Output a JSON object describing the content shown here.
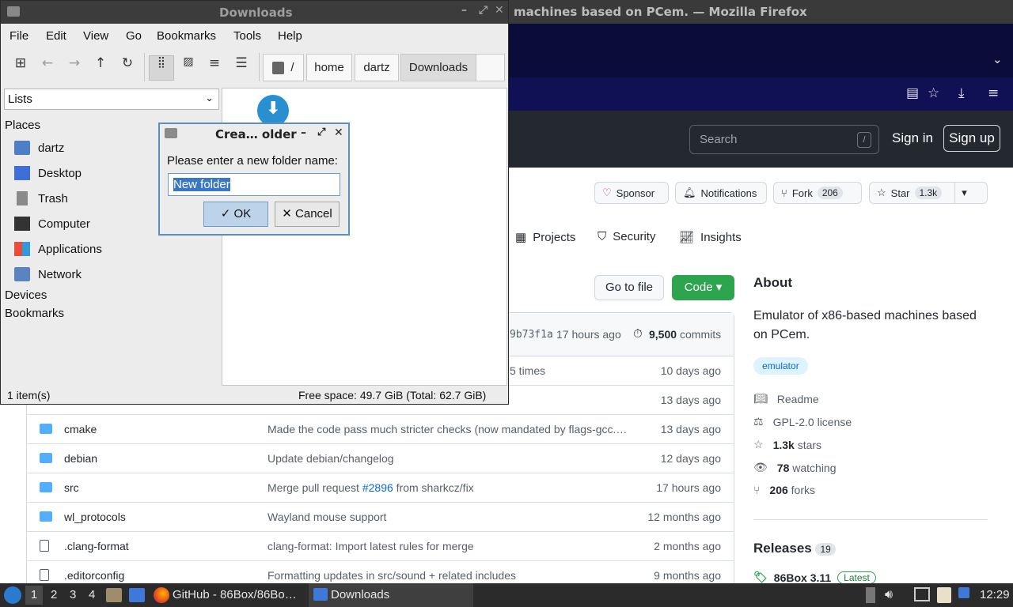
{
  "firefox": {
    "window_title": "machines based on PCem. — Mozilla Firefox",
    "search_placeholder": "Search",
    "search_shortcut": "/",
    "sign_in": "Sign in",
    "sign_up": "Sign up",
    "sponsor": "Sponsor",
    "notifications": "Notifications",
    "fork": "Fork",
    "fork_count": "206",
    "star": "Star",
    "star_count": "1.3k",
    "tabs": [
      "Projects",
      "Security",
      "Insights"
    ],
    "go_to_file": "Go to file",
    "code": "Code ▾",
    "commit_hash": "9b73f1a",
    "commit_time": "17 hours ago",
    "commit_count": "9,500",
    "commits_label": "commits",
    "partial_row_msg": "5 times",
    "partial_row_date": "10 days ago",
    "partial_row2_date": "13 days ago",
    "files": [
      {
        "name": "cmake",
        "msg": "Made the code pass much stricter checks (now mandated by flags-gcc.…",
        "date": "13 days ago",
        "type": "folder"
      },
      {
        "name": "debian",
        "msg": "Update debian/changelog",
        "date": "12 days ago",
        "type": "folder"
      },
      {
        "name": "src",
        "msg_pre": "Merge pull request ",
        "msg_link": "#2896",
        "msg_post": " from sharkcz/fix",
        "date": "17 hours ago",
        "type": "folder"
      },
      {
        "name": "wl_protocols",
        "msg": "Wayland mouse support",
        "date": "12 months ago",
        "type": "folder"
      },
      {
        "name": ".clang-format",
        "msg": "clang-format: Import latest rules for merge",
        "date": "2 months ago",
        "type": "file"
      },
      {
        "name": ".editorconfig",
        "msg": "Formatting updates in src/sound + related includes",
        "date": "9 months ago",
        "type": "file"
      }
    ],
    "about": {
      "heading": "About",
      "description": "Emulator of x86-based machines based on PCem.",
      "topic": "emulator",
      "readme": "Readme",
      "license": "GPL-2.0 license",
      "stars_num": "1.3k",
      "stars_label": "stars",
      "watching_num": "78",
      "watching_label": "watching",
      "forks_num": "206",
      "forks_label": "forks",
      "releases": "Releases",
      "releases_count": "19",
      "latest_release": "86Box 3.11",
      "latest_badge": "Latest"
    }
  },
  "file_manager": {
    "title": "Downloads",
    "menu": [
      "File",
      "Edit",
      "View",
      "Go",
      "Bookmarks",
      "Tools",
      "Help"
    ],
    "breadcrumb": [
      "/",
      "home",
      "dartz",
      "Downloads"
    ],
    "side_mode": "Lists",
    "places_heading": "Places",
    "places": [
      "dartz",
      "Desktop",
      "Trash",
      "Computer",
      "Applications",
      "Network"
    ],
    "devices_heading": "Devices",
    "bookmarks_heading": "Bookmarks",
    "status_items": "1 item(s)",
    "status_free": "Free space: 49.7 GiB (Total: 62.7 GiB)"
  },
  "dialog": {
    "title": "Crea… older",
    "prompt": "Please enter a new folder name:",
    "value": "New folder",
    "ok": "OK",
    "cancel": "Cancel"
  },
  "taskbar": {
    "workspaces": [
      "1",
      "2",
      "3",
      "4"
    ],
    "tasks": [
      "GitHub - 86Box/86Bo…",
      "Downloads"
    ],
    "clock": "12:29"
  }
}
